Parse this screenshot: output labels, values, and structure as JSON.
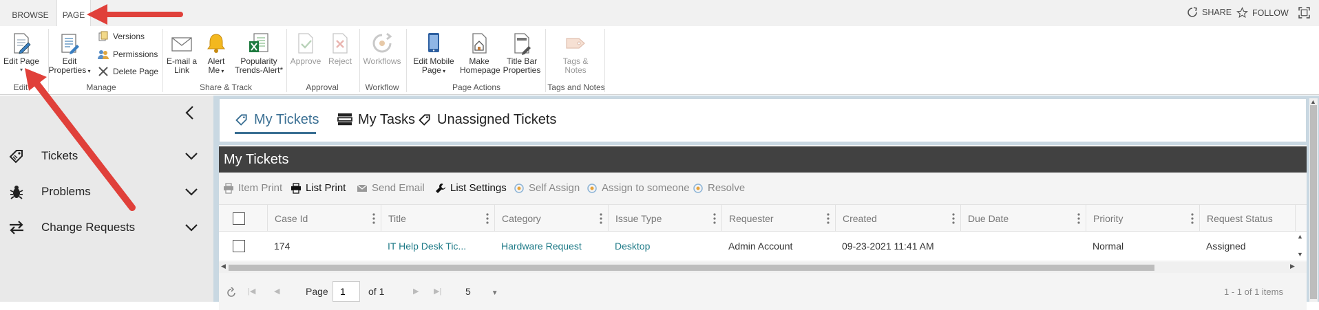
{
  "top_tabs": {
    "browse": "BROWSE",
    "page": "PAGE"
  },
  "top_actions": {
    "share": "SHARE",
    "follow": "FOLLOW"
  },
  "ribbon": {
    "edit_page": "Edit Page",
    "edit_properties_line1": "Edit",
    "edit_properties_line2": "Properties",
    "versions": "Versions",
    "permissions": "Permissions",
    "delete_page": "Delete Page",
    "email_link_line1": "E-mail a",
    "email_link_line2": "Link",
    "alert_me_line1": "Alert",
    "alert_me_line2": "Me",
    "popularity_line1": "Popularity",
    "popularity_line2": "Trends-Alert*",
    "approve": "Approve",
    "reject": "Reject",
    "workflows": "Workflows",
    "edit_mobile_line1": "Edit Mobile",
    "edit_mobile_line2": "Page",
    "make_homepage_line1": "Make",
    "make_homepage_line2": "Homepage",
    "title_bar_line1": "Title Bar",
    "title_bar_line2": "Properties",
    "tags_notes_line1": "Tags &",
    "tags_notes_line2": "Notes",
    "groups": {
      "edit": "Edit",
      "manage": "Manage",
      "share_track": "Share & Track",
      "approval": "Approval",
      "workflow": "Workflow",
      "page_actions": "Page Actions",
      "tags_notes": "Tags and Notes"
    }
  },
  "sidebar": {
    "items": [
      {
        "label": "Tickets"
      },
      {
        "label": "Problems"
      },
      {
        "label": "Change Requests"
      }
    ]
  },
  "main_tabs": [
    {
      "label": "My Tickets"
    },
    {
      "label": "My Tasks"
    },
    {
      "label": "Unassigned Tickets"
    }
  ],
  "grid": {
    "title": "My Tickets",
    "toolbar": {
      "item_print": "Item Print",
      "list_print": "List Print",
      "send_email": "Send Email",
      "list_settings": "List Settings",
      "self_assign": "Self Assign",
      "assign_to_someone": "Assign to someone",
      "resolve": "Resolve"
    },
    "columns": [
      "Case Id",
      "Title",
      "Category",
      "Issue Type",
      "Requester",
      "Created",
      "Due Date",
      "Priority",
      "Request Status"
    ],
    "rows": [
      [
        "174",
        "IT Help Desk Tic...",
        "Hardware Request",
        "Desktop",
        "Admin Account",
        "09-23-2021 11:41 AM",
        "",
        "Normal",
        "Assigned"
      ]
    ],
    "pager": {
      "page_label": "Page",
      "page_value": "1",
      "of_label": "of 1",
      "page_size": "5",
      "items_info": "1 - 1 of 1 items"
    }
  },
  "colors": {
    "accent": "#3a6f93",
    "link": "#1e7a87",
    "annotation_arrow": "#e0403a",
    "grid_header": "#414141"
  }
}
